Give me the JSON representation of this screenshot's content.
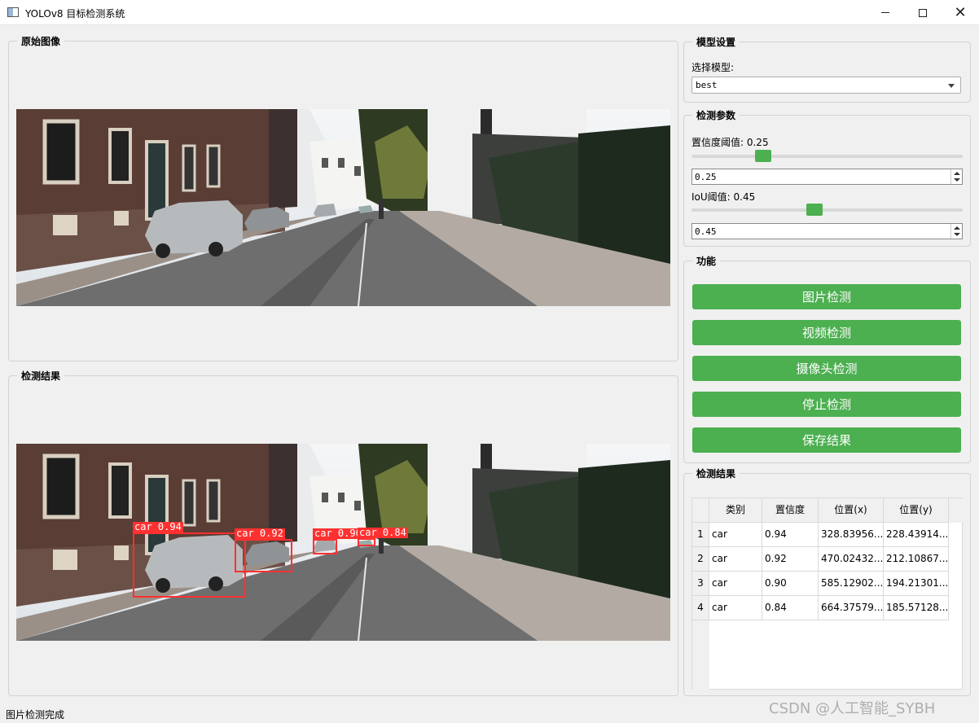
{
  "window": {
    "title": "YOLOv8 目标检测系统"
  },
  "original_image": {
    "title": "原始图像"
  },
  "result_image": {
    "title": "检测结果",
    "detections": [
      {
        "label": "car 0.94"
      },
      {
        "label": "car 0.92"
      },
      {
        "label": "car 0.90"
      },
      {
        "label": "car 0.84"
      }
    ]
  },
  "model_settings": {
    "title": "模型设置",
    "select_label": "选择模型:",
    "selected_model": "best"
  },
  "detection_params": {
    "title": "检测参数",
    "confidence_label": "置信度阈值: 0.25",
    "confidence_value": "0.25",
    "confidence_fraction": 0.25,
    "iou_label": "IoU阈值: 0.45",
    "iou_value": "0.45",
    "iou_fraction": 0.45
  },
  "functions": {
    "title": "功能",
    "buttons": [
      "图片检测",
      "视频检测",
      "摄像头检测",
      "停止检测",
      "保存结果"
    ],
    "button_color": "#4caf50"
  },
  "results_table": {
    "title": "检测结果",
    "headers": [
      "类别",
      "置信度",
      "位置(x)",
      "位置(y)"
    ],
    "rows": [
      {
        "index": "1",
        "cells": [
          "car",
          "0.94",
          "328.83956...",
          "228.43914..."
        ]
      },
      {
        "index": "2",
        "cells": [
          "car",
          "0.92",
          "470.02432...",
          "212.10867..."
        ]
      },
      {
        "index": "3",
        "cells": [
          "car",
          "0.90",
          "585.12902...",
          "194.21301..."
        ]
      },
      {
        "index": "4",
        "cells": [
          "car",
          "0.84",
          "664.37579...",
          "185.57128..."
        ]
      }
    ]
  },
  "status_bar": {
    "text": "图片检测完成"
  },
  "watermark": "CSDN @人工智能_SYBH"
}
